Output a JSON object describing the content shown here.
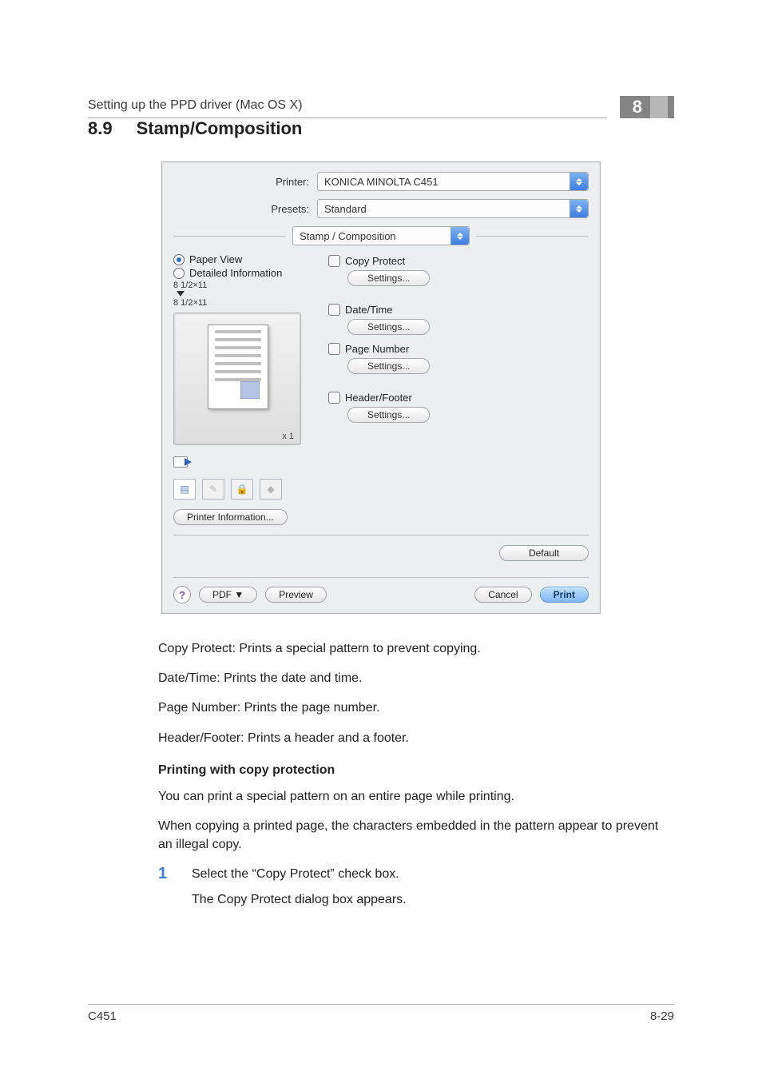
{
  "header": {
    "running_title": "Setting up the PPD driver (Mac OS X)",
    "chapter_number": "8"
  },
  "heading": {
    "number": "8.9",
    "title": "Stamp/Composition"
  },
  "dialog": {
    "printer_label": "Printer:",
    "printer_value": "KONICA MINOLTA C451",
    "presets_label": "Presets:",
    "presets_value": "Standard",
    "panel_value": "Stamp / Composition",
    "view_options": {
      "paper_view": "Paper View",
      "detailed_info": "Detailed Information",
      "selected": "paper_view"
    },
    "size_1": "8 1/2×11",
    "size_2": "8 1/2×11",
    "preview_multiplier": "x 1",
    "printer_info_button": "Printer Information...",
    "copy_protect": {
      "label": "Copy Protect",
      "settings": "Settings..."
    },
    "date_time": {
      "label": "Date/Time",
      "settings": "Settings..."
    },
    "page_number": {
      "label": "Page Number",
      "settings": "Settings..."
    },
    "header_footer": {
      "label": "Header/Footer",
      "settings": "Settings..."
    },
    "default_button": "Default",
    "help_symbol": "?",
    "pdf_button": "PDF ▼",
    "preview_button": "Preview",
    "cancel_button": "Cancel",
    "print_button": "Print"
  },
  "descriptions": {
    "copy_protect": "Copy Protect: Prints a special pattern to prevent copying.",
    "date_time": "Date/Time: Prints the date and time.",
    "page_number": "Page Number: Prints the page number.",
    "header_footer": "Header/Footer: Prints a header and a footer."
  },
  "section": {
    "subheading": "Printing with copy protection",
    "intro1": "You can print a special pattern on an entire page while printing.",
    "intro2": "When copying a printed page, the characters embedded in the pattern appear to prevent an illegal copy.",
    "step1_num": "1",
    "step1_text": "Select the “Copy Protect” check box.",
    "step1_result": "The Copy Protect dialog box appears."
  },
  "footer": {
    "model": "C451",
    "page": "8-29"
  }
}
